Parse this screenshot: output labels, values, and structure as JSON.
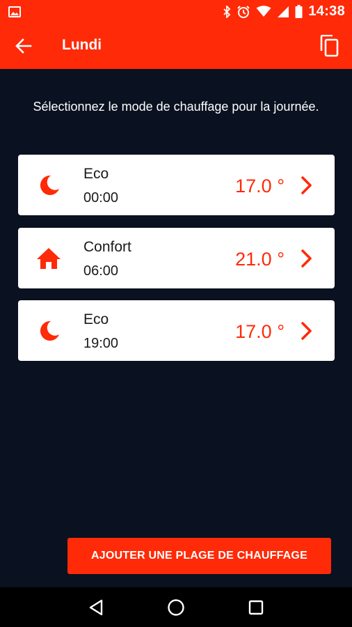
{
  "status_bar": {
    "time": "14:38",
    "icons": [
      "image-icon",
      "bluetooth-icon",
      "alarm-icon",
      "wifi-icon",
      "signal-icon",
      "battery-icon"
    ]
  },
  "app_bar": {
    "title": "Lundi",
    "back_icon": "arrow-back-icon",
    "action_icon": "copy-icon"
  },
  "instruction": "Sélectionnez le mode de chauffage pour la journée.",
  "schedule": [
    {
      "mode": "Eco",
      "time": "00:00",
      "temperature": "17.0 °",
      "icon": "moon-icon"
    },
    {
      "mode": "Confort",
      "time": "06:00",
      "temperature": "21.0 °",
      "icon": "home-icon"
    },
    {
      "mode": "Eco",
      "time": "19:00",
      "temperature": "17.0 °",
      "icon": "moon-icon"
    }
  ],
  "add_button_label": "AJOUTER UNE PLAGE DE CHAUFFAGE",
  "colors": {
    "accent": "#ff2a08",
    "background": "#0a1120",
    "card": "#ffffff"
  }
}
